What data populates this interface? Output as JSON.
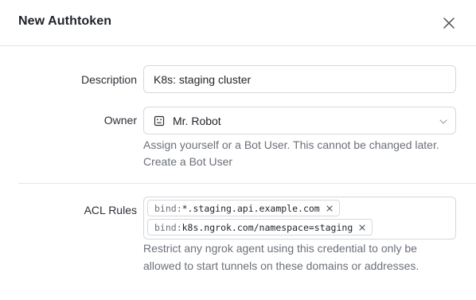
{
  "dialog": {
    "title": "New Authtoken",
    "close_icon": "close-icon"
  },
  "form": {
    "description": {
      "label": "Description",
      "value": "K8s: staging cluster"
    },
    "owner": {
      "label": "Owner",
      "value": "Mr. Robot",
      "icon": "robot-icon",
      "chevron_icon": "chevron-down-icon",
      "help": "Assign yourself or a Bot User. This cannot be changed later.",
      "link": "Create a Bot User"
    },
    "acl": {
      "label": "ACL Rules",
      "tags": [
        {
          "prefix": "bind:",
          "value": "*.staging.api.example.com"
        },
        {
          "prefix": "bind:",
          "value": "k8s.ngrok.com/namespace=staging"
        }
      ],
      "help_line1": "Restrict any ngrok agent using this credential to only be",
      "help_line2": "allowed to start tunnels on these domains or addresses."
    }
  }
}
